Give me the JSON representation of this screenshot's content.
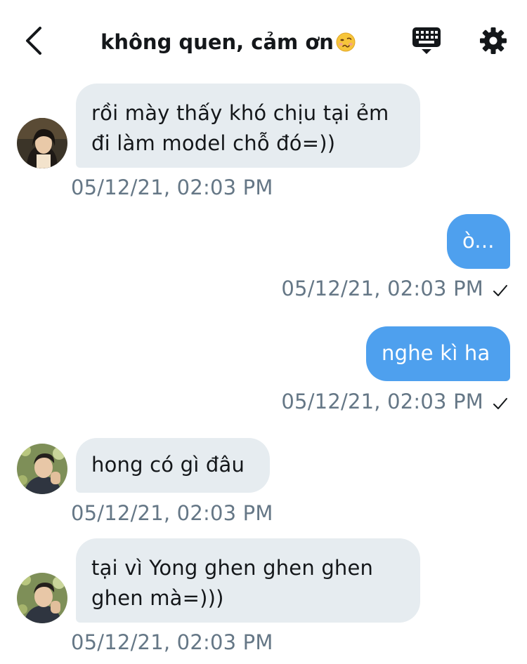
{
  "header": {
    "title": "không quen, cảm ơn",
    "title_emoji": "woozy-face-emoji"
  },
  "colors": {
    "incoming_bubble": "#e6ecf0",
    "outgoing_bubble": "#4ea0ee",
    "timestamp": "#657786"
  },
  "messages": [
    {
      "direction": "incoming",
      "lines": [
        "rồi mày thấy khó chịu tại ẻm",
        "đi làm model chỗ đó=))"
      ],
      "timestamp": "05/12/21, 02:03 PM"
    },
    {
      "direction": "outgoing",
      "lines": [
        "ò..."
      ],
      "timestamp": "05/12/21, 02:03 PM",
      "read": true
    },
    {
      "direction": "outgoing",
      "lines": [
        "nghe kì ha"
      ],
      "timestamp": "05/12/21, 02:03 PM",
      "read": true
    },
    {
      "direction": "incoming",
      "lines": [
        "hong có gì đâu"
      ],
      "timestamp": "05/12/21, 02:03 PM"
    },
    {
      "direction": "incoming",
      "lines": [
        "tại vì Yong ghen ghen ghen",
        "ghen mà=)))"
      ],
      "timestamp": "05/12/21, 02:03 PM"
    }
  ]
}
